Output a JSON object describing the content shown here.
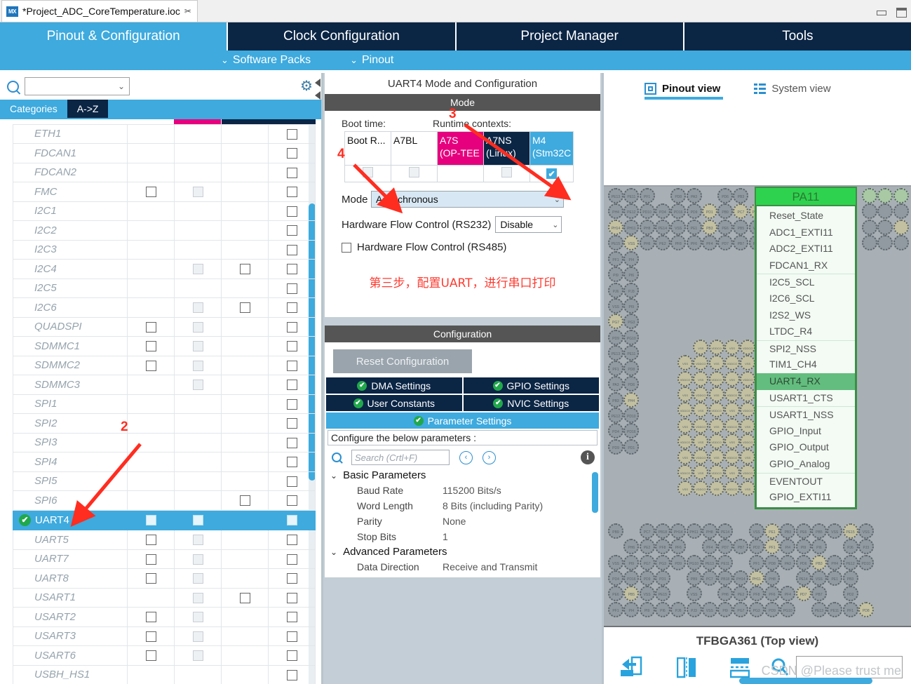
{
  "window": {
    "doc_tab_title": "*Project_ADC_CoreTemperature.ioc",
    "logo_text": "MX",
    "close_glyph": "✂"
  },
  "ribbon": {
    "tabs": [
      {
        "label": "Pinout & Configuration",
        "active": true
      },
      {
        "label": "Clock Configuration",
        "active": false
      },
      {
        "label": "Project Manager",
        "active": false
      },
      {
        "label": "Tools",
        "active": false
      }
    ],
    "subbar": [
      {
        "label": "Software Packs",
        "chevron": "⌄"
      },
      {
        "label": "Pinout",
        "chevron": "⌄"
      }
    ]
  },
  "left": {
    "search_value": "",
    "search_arrow": "⌄",
    "gear_icon": "⚙",
    "tabs": [
      {
        "label": "Categories",
        "selected": true
      },
      {
        "label": "A->Z",
        "selected": false
      }
    ],
    "peripherals": [
      {
        "name": "ETH1",
        "cells": [
          "",
          "",
          "",
          "box"
        ]
      },
      {
        "name": "FDCAN1",
        "cells": [
          "",
          "",
          "",
          "box"
        ]
      },
      {
        "name": "FDCAN2",
        "cells": [
          "",
          "",
          "",
          "box"
        ]
      },
      {
        "name": "FMC",
        "cells": [
          "box",
          "dim",
          "",
          "box"
        ]
      },
      {
        "name": "I2C1",
        "cells": [
          "",
          "",
          "",
          "box"
        ]
      },
      {
        "name": "I2C2",
        "cells": [
          "",
          "",
          "",
          "box"
        ]
      },
      {
        "name": "I2C3",
        "cells": [
          "",
          "",
          "",
          "box"
        ]
      },
      {
        "name": "I2C4",
        "cells": [
          "",
          "dim",
          "box",
          "box"
        ]
      },
      {
        "name": "I2C5",
        "cells": [
          "",
          "",
          "",
          "box"
        ]
      },
      {
        "name": "I2C6",
        "cells": [
          "",
          "dim",
          "box",
          "box"
        ]
      },
      {
        "name": "QUADSPI",
        "cells": [
          "box",
          "dim",
          "",
          "box"
        ]
      },
      {
        "name": "SDMMC1",
        "cells": [
          "box",
          "dim",
          "",
          "box"
        ]
      },
      {
        "name": "SDMMC2",
        "cells": [
          "box",
          "dim",
          "",
          "box"
        ]
      },
      {
        "name": "SDMMC3",
        "cells": [
          "",
          "dim",
          "",
          "box"
        ]
      },
      {
        "name": "SPI1",
        "cells": [
          "",
          "",
          "",
          "box"
        ]
      },
      {
        "name": "SPI2",
        "cells": [
          "",
          "",
          "",
          "box"
        ]
      },
      {
        "name": "SPI3",
        "cells": [
          "",
          "",
          "",
          "box"
        ]
      },
      {
        "name": "SPI4",
        "cells": [
          "",
          "",
          "",
          "box"
        ]
      },
      {
        "name": "SPI5",
        "cells": [
          "",
          "",
          "",
          "box"
        ]
      },
      {
        "name": "SPI6",
        "cells": [
          "",
          "",
          "box",
          "box"
        ]
      },
      {
        "name": "UART4",
        "cells": [
          "box",
          "box",
          "",
          "box"
        ],
        "selected": true,
        "check_glyph": "✔"
      },
      {
        "name": "UART5",
        "cells": [
          "box",
          "dim",
          "",
          "box"
        ]
      },
      {
        "name": "UART7",
        "cells": [
          "box",
          "dim",
          "",
          "box"
        ]
      },
      {
        "name": "UART8",
        "cells": [
          "box",
          "dim",
          "",
          "box"
        ]
      },
      {
        "name": "USART1",
        "cells": [
          "",
          "dim",
          "box",
          "box"
        ]
      },
      {
        "name": "USART2",
        "cells": [
          "box",
          "dim",
          "",
          "box"
        ]
      },
      {
        "name": "USART3",
        "cells": [
          "box",
          "dim",
          "",
          "box"
        ]
      },
      {
        "name": "USART6",
        "cells": [
          "box",
          "dim",
          "",
          "box"
        ]
      },
      {
        "name": "USBH_HS1",
        "cells": [
          "",
          "",
          "",
          "box"
        ]
      }
    ]
  },
  "middle": {
    "title": "UART4 Mode and Configuration",
    "mode_header": "Mode",
    "boot_time_label": "Boot time:",
    "runtime_label": "Runtime contexts:",
    "contexts": [
      {
        "line1": "Boot R...",
        "line2": "",
        "style": "boot",
        "checkbox": "dim"
      },
      {
        "line1": "A7BL",
        "line2": "",
        "style": "a7bl",
        "checkbox": "dim"
      },
      {
        "line1": "A7S",
        "line2": "(OP-TEE",
        "style": "a7s",
        "checkbox": "none"
      },
      {
        "line1": "A7NS",
        "line2": "(Linux)",
        "style": "a7ns",
        "checkbox": "dim"
      },
      {
        "line1": "M4",
        "line2": "(Stm32C",
        "style": "m4",
        "checkbox": "checked",
        "check_glyph": "✔"
      }
    ],
    "mode_field_label": "Mode",
    "mode_field_value": "Asynchronous",
    "hw_rs232_label": "Hardware Flow Control (RS232)",
    "hw_rs232_value": "Disable",
    "hw_rs485_label": "Hardware Flow Control (RS485)",
    "hw_rs485_checked": false,
    "annotation_cn": "第三步，配置UART，进行串口打印",
    "config_header": "Configuration",
    "reset_button": "Reset Configuration",
    "config_tabs": [
      {
        "label": "DMA Settings",
        "active": false
      },
      {
        "label": "GPIO Settings",
        "active": false
      },
      {
        "label": "User Constants",
        "active": false
      },
      {
        "label": "NVIC Settings",
        "active": false
      },
      {
        "label": "Parameter Settings",
        "active": true
      }
    ],
    "configure_note": "Configure the below parameters :",
    "search_placeholder": "Search (Crtl+F)",
    "nav_prev": "‹",
    "nav_next": "›",
    "info_glyph": "i",
    "param_groups": [
      {
        "name": "Basic Parameters",
        "chevron": "⌄",
        "rows": [
          {
            "label": "Baud Rate",
            "value": "115200 Bits/s"
          },
          {
            "label": "Word Length",
            "value": "8 Bits (including Parity)"
          },
          {
            "label": "Parity",
            "value": "None"
          },
          {
            "label": "Stop Bits",
            "value": "1"
          }
        ]
      },
      {
        "name": "Advanced Parameters",
        "chevron": "⌄",
        "rows": [
          {
            "label": "Data Direction",
            "value": "Receive and Transmit"
          }
        ]
      }
    ]
  },
  "right": {
    "view_tabs": [
      {
        "label": "Pinout view",
        "active": true,
        "icon": "chip-icon"
      },
      {
        "label": "System view",
        "active": false,
        "icon": "system-view-icon"
      }
    ],
    "selected_pin": "PA11",
    "pin_menu": [
      {
        "label": "Reset_State",
        "selected": false,
        "sep": false
      },
      {
        "label": "ADC1_EXTI11",
        "selected": false,
        "sep": false
      },
      {
        "label": "ADC2_EXTI11",
        "selected": false,
        "sep": false
      },
      {
        "label": "FDCAN1_RX",
        "selected": false,
        "sep": false
      },
      {
        "label": "I2C5_SCL",
        "selected": false,
        "sep": true
      },
      {
        "label": "I2C6_SCL",
        "selected": false,
        "sep": false
      },
      {
        "label": "I2S2_WS",
        "selected": false,
        "sep": false
      },
      {
        "label": "LTDC_R4",
        "selected": false,
        "sep": false
      },
      {
        "label": "SPI2_NSS",
        "selected": false,
        "sep": true
      },
      {
        "label": "TIM1_CH4",
        "selected": false,
        "sep": false
      },
      {
        "label": "UART4_RX",
        "selected": true,
        "sep": false
      },
      {
        "label": "USART1_CTS",
        "selected": false,
        "sep": false
      },
      {
        "label": "USART1_NSS",
        "selected": false,
        "sep": true
      },
      {
        "label": "GPIO_Input",
        "selected": false,
        "sep": false
      },
      {
        "label": "GPIO_Output",
        "selected": false,
        "sep": false
      },
      {
        "label": "GPIO_Analog",
        "selected": false,
        "sep": false
      },
      {
        "label": "EVENTOUT",
        "selected": false,
        "sep": true
      },
      {
        "label": "GPIO_EXTI11",
        "selected": false,
        "sep": false
      }
    ],
    "package_title": "TFBGA361 (Top view)",
    "search_value": "",
    "watermark": "CSDN @Please trust me"
  },
  "annotations": [
    {
      "id": "2",
      "label": "2"
    },
    {
      "id": "3",
      "label": "3"
    },
    {
      "id": "4",
      "label": "4"
    }
  ],
  "colors": {
    "accent": "#3eaade",
    "navy": "#0b2545",
    "pink": "#e6007e",
    "green": "#21a84b",
    "annotation_red": "#ff2d20"
  }
}
